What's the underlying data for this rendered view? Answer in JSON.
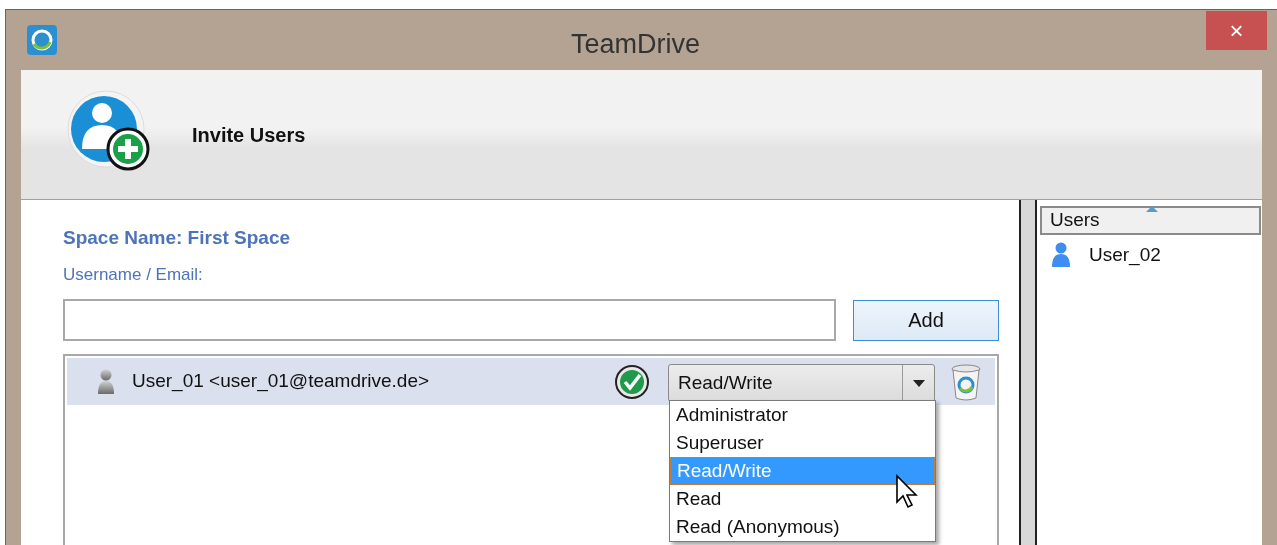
{
  "window": {
    "title": "TeamDrive",
    "close": "×"
  },
  "header": {
    "title": "Invite Users"
  },
  "form": {
    "space_name": "Space Name: First Space",
    "username_label": "Username / Email:",
    "add_button": "Add"
  },
  "invitees": [
    {
      "label": "User_01 <user_01@teamdrive.de>",
      "selected": true,
      "verified": true,
      "role": "Read/Write",
      "dropdown_open": true
    }
  ],
  "role_options": [
    {
      "label": "Administrator",
      "selected": false
    },
    {
      "label": "Superuser",
      "selected": false
    },
    {
      "label": "Read/Write",
      "selected": true
    },
    {
      "label": "Read",
      "selected": false
    },
    {
      "label": "Read (Anonymous)",
      "selected": false
    }
  ],
  "users_panel": {
    "column": "Users",
    "items": [
      {
        "label": "User_02"
      }
    ]
  }
}
